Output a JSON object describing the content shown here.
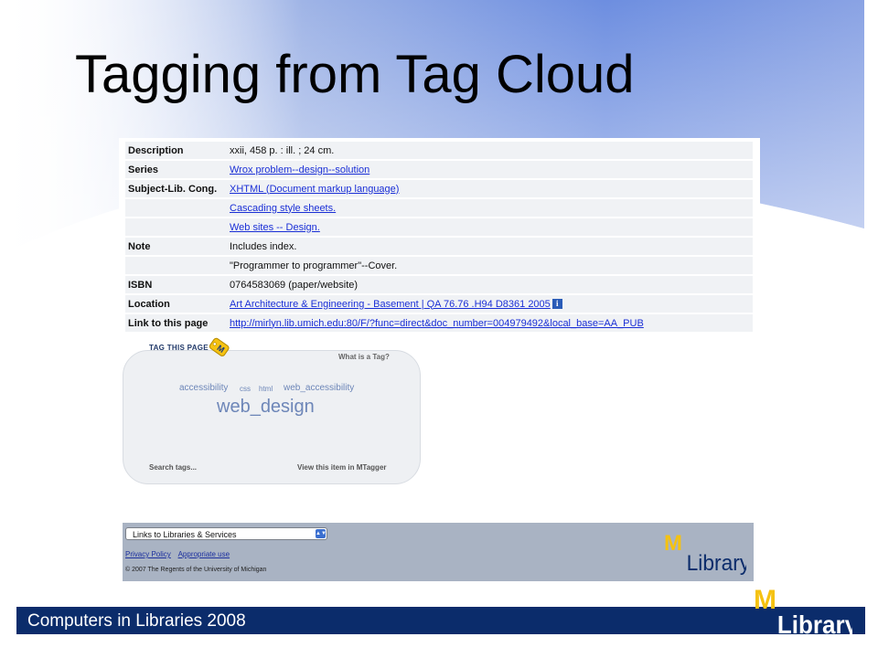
{
  "slide": {
    "title": "Tagging from Tag Cloud",
    "footer_text": "Computers in Libraries 2008",
    "colors": {
      "bar": "#0b2c6b",
      "accent_yellow": "#f5c211",
      "link": "#1a2fd6"
    }
  },
  "record": {
    "rows": [
      {
        "label": "Description",
        "value": "xxii, 458 p. :  ill. ;  24 cm.",
        "link": false
      },
      {
        "label": "Series",
        "value": "Wrox problem--design--solution",
        "link": true
      },
      {
        "label": "Subject-Lib. Cong.",
        "value": "XHTML (Document markup language)",
        "link": true
      },
      {
        "label": "",
        "value": "Cascading style sheets.",
        "link": true
      },
      {
        "label": "",
        "value": "Web sites -- Design.",
        "link": true
      },
      {
        "label": "Note",
        "value": "Includes index.",
        "link": false
      },
      {
        "label": "",
        "value": "\"Programmer to programmer\"--Cover.",
        "link": false
      },
      {
        "label": "ISBN",
        "value": "0764583069 (paper/website)",
        "link": false
      },
      {
        "label": "Location",
        "value": "Art Architecture & Engineering - Basement | QA 76.76 .H94 D8361 2005",
        "link": true,
        "icon": "info-icon",
        "icon_glyph": "i"
      },
      {
        "label": "Link to this page",
        "value": "http://mirlyn.lib.umich.edu:80/F/?func=direct&doc_number=004979492&local_base=AA_PUB",
        "link": true
      }
    ]
  },
  "tag_widget": {
    "tag_this_page": "TAG THIS PAGE",
    "badge_letter": "M",
    "what_is_tag": "What is a Tag?",
    "tags_row": [
      "accessibility",
      "css",
      "html",
      "web_accessibility"
    ],
    "main_tag": "web_design",
    "search_tags": "Search tags...",
    "view_mtagger": "View this item in MTagger"
  },
  "page_footer": {
    "select_value": "Links to Libraries & Services",
    "select_arrow": "▲▼",
    "privacy_policy": "Privacy Policy",
    "appropriate_use": "Appropriate use",
    "copyright": "© 2007 The Regents of the University of Michigan",
    "logo_text": "Library",
    "logo_letter": "M"
  }
}
